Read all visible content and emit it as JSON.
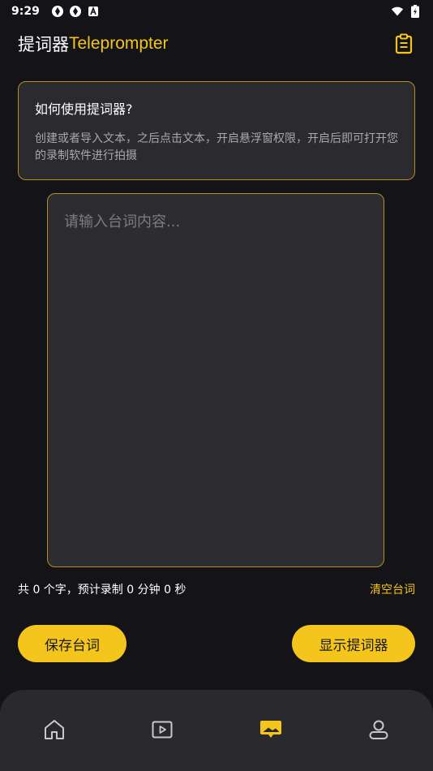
{
  "status_bar": {
    "time": "9:29",
    "icons_left": [
      "app-notification-icon",
      "app-notification-icon",
      "text-a-icon"
    ],
    "icons_right": [
      "wifi-icon",
      "battery-charging-icon"
    ]
  },
  "header": {
    "title_cn": "提词器",
    "title_en": "Teleprompter",
    "action_icon": "clipboard-icon"
  },
  "info_card": {
    "title": "如何使用提词器?",
    "description": "创建或者导入文本，之后点击文本，开启悬浮窗权限，开启后即可打开您的录制软件进行拍摄"
  },
  "editor": {
    "placeholder": "请输入台词内容...",
    "value": ""
  },
  "stats": {
    "count_text": "共 0 个字，预计录制 0 分钟 0 秒",
    "clear_label": "清空台词"
  },
  "buttons": {
    "save_label": "保存台词",
    "show_label": "显示提词器"
  },
  "bottom_nav": {
    "items": [
      "home-icon",
      "video-play-icon",
      "teleprompter-icon",
      "profile-icon"
    ],
    "active_index": 2
  },
  "colors": {
    "accent": "#f4c51c",
    "background": "#141318",
    "card": "#2a2a2f",
    "border": "#b48f1e",
    "muted_text": "#a9a8ad",
    "nav_inactive": "#c9c8cc"
  }
}
